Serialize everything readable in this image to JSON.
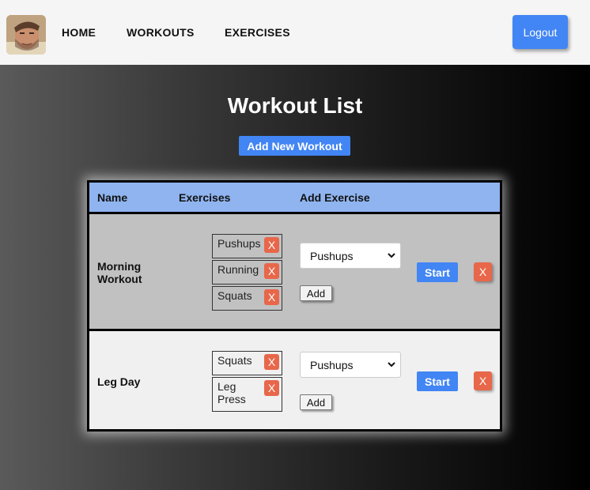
{
  "nav": {
    "avatar_alt": "profile photo",
    "links": [
      "HOME",
      "WORKOUTS",
      "EXERCISES"
    ],
    "logout_label": "Logout"
  },
  "main": {
    "title": "Workout List",
    "add_workout_label": "Add New Workout"
  },
  "table": {
    "headers": [
      "Name",
      "Exercises",
      "Add Exercise"
    ],
    "rows": [
      {
        "name": "Morning Workout",
        "exercises": [
          "Pushups",
          "Running",
          "Squats"
        ],
        "remove_label": "X",
        "select_value": "Pushups",
        "add_label": "Add",
        "start_label": "Start",
        "delete_label": "X"
      },
      {
        "name": "Leg Day",
        "exercises": [
          "Squats",
          "Leg Press"
        ],
        "remove_label": "X",
        "select_value": "Pushups",
        "add_label": "Add",
        "start_label": "Start",
        "delete_label": "X"
      }
    ]
  },
  "colors": {
    "navbar_bg": "#f5f5f5",
    "primary_button": "#4285f4",
    "danger_button": "#e8674a",
    "header_bg": "#8fb4ef",
    "row1_bg": "#c1c1c1",
    "row2_bg": "#f0f0f0"
  }
}
